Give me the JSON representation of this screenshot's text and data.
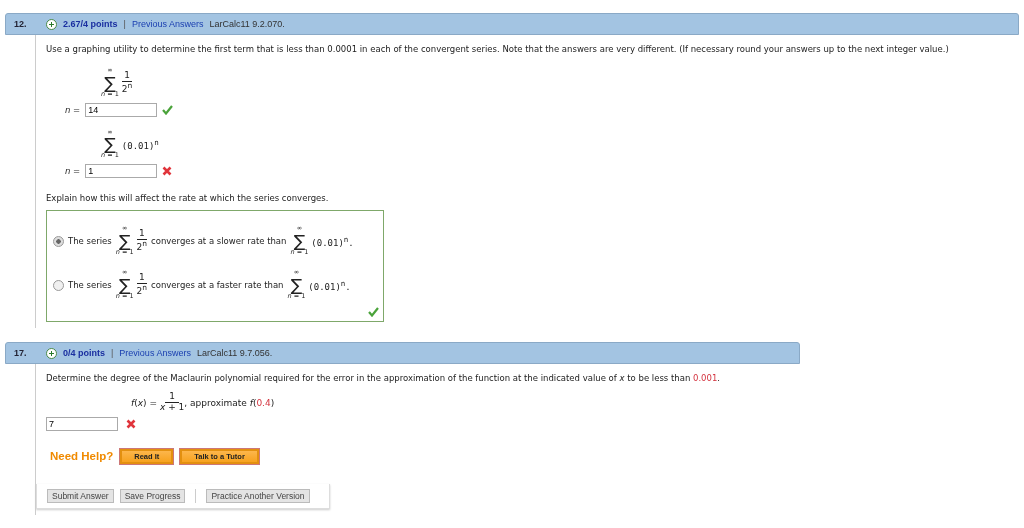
{
  "questions": [
    {
      "number": "12.",
      "points": "2.67/4 points",
      "separator": "|",
      "link": "Previous Answers",
      "source": "LarCalc11 9.2.070.",
      "prompt": "Use a graphing utility to determine the first term that is less than 0.0001 in each of the convergent series. Note that the answers are very different. (If necessary round your answers up to the next integer value.)",
      "parts": [
        {
          "series": {
            "sigma": "∑",
            "upper": "∞",
            "lower": "*n* = 1",
            "kind": "fraction",
            "numerator": "1",
            "denominator": "2$^{n}$"
          },
          "label": "*n* =",
          "answer": "14",
          "correct": true
        },
        {
          "series": {
            "sigma": "∑",
            "upper": "∞",
            "lower": "*n* = 1",
            "kind": "power",
            "term": "(0.01)$^{n}$"
          },
          "label": "*n* =",
          "answer": "1",
          "correct": false
        }
      ],
      "explain": {
        "prompt": "Explain how this will affect the rate at which the series converges.",
        "correct": true,
        "options": [
          {
            "selected": true,
            "lead": "The series",
            "left": {
              "sigma": "∑",
              "upper": "∞",
              "lower": "*n* = 1",
              "kind": "fraction",
              "numerator": "1",
              "denominator": "2$^{n}$"
            },
            "middle": "converges at a slower rate than",
            "right": {
              "sigma": "∑",
              "upper": "∞",
              "lower": "*n* = 1",
              "kind": "power",
              "term": "(0.01)$^{n}$."
            }
          },
          {
            "selected": false,
            "lead": "The series",
            "left": {
              "sigma": "∑",
              "upper": "∞",
              "lower": "*n* = 1",
              "kind": "fraction",
              "numerator": "1",
              "denominator": "2$^{n}$"
            },
            "middle": "converges at a faster rate than",
            "right": {
              "sigma": "∑",
              "upper": "∞",
              "lower": "*n* = 1",
              "kind": "power",
              "term": "(0.01)$^{n}$."
            }
          }
        ]
      }
    },
    {
      "number": "17.",
      "points": "0/4 points",
      "separator": "|",
      "link": "Previous Answers",
      "source": "LarCalc11 9.7.056.",
      "prompt": {
        "text": "Determine the degree of the Maclaurin polynomial required for the error in the approximation of the function at the indicated value of *x* to be less than",
        "value": "0.001",
        "end": "."
      },
      "function": {
        "lhs": "*f*(*x*) =",
        "numerator": "1",
        "denominator": "*x* + 1",
        "after": ", approximate *f*(",
        "value": "0.4",
        "close": ")"
      },
      "answer": "7",
      "correct": false,
      "help": {
        "label": "Need Help?",
        "buttons": [
          "Read It",
          "Talk to a Tutor"
        ]
      },
      "actions": [
        {
          "label": "Submit Answer",
          "kind": "button"
        },
        {
          "label": "Save Progress",
          "kind": "button"
        },
        {
          "kind": "divider"
        },
        {
          "label": "Practice Another Version",
          "kind": "button"
        }
      ]
    }
  ]
}
